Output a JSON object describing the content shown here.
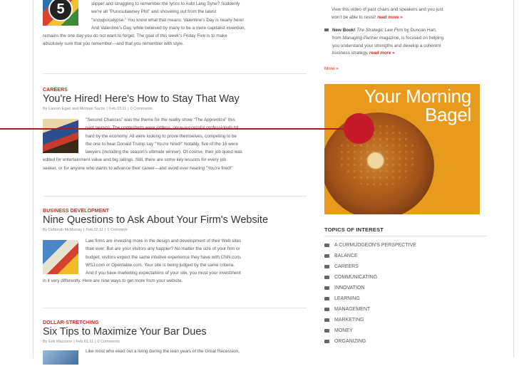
{
  "main": {
    "friday_five": {
      "lines": [
        "slipper and struggling to remember the lyrics to Auld Lang Syne? Suddenly",
        "we're all \"Punxsutawney Phil\" and shoveling out from the latest",
        "\"snowpocalypse.\" You know what that means: Valentine's Day is nearly here!",
        "And Valentine's Day, while believed by many to be a mere capitalist invention,",
        "remains the one day you do not want to forget. The goal of this week's Friday Five is to make",
        "absolutely sure that you remember—and that you remember with style."
      ],
      "badge_number": "5"
    },
    "articles": [
      {
        "category": "CAREERS",
        "title": "You're Hired! Here's How to Stay That Way",
        "authors": "By Lauren Egan and Michael Sachs",
        "date": "Feb.03.11",
        "comments": "0 Comments",
        "lines": [
          "\"Second Chances\" was the theme for the reality show \"The Apprentice\" this",
          "past season. The contestants were jobless, once-successful professionals hit",
          "hard by the economy. All were looking to prove themselves, competing to be",
          "the one to hear Donald Trump say \"You're hired!\" Notably, five of the 16 were",
          "lawyers (including the season's ultimate winner). Of course, their job quest was",
          "edited for entertainment value and big ratings. Still, there are some key lessons for every job",
          "seeker, or for anyone who wants to advance their career—and avoid ever hearing \"You're fired!\""
        ]
      },
      {
        "category": "BUSINESS DEVELOPMENT",
        "title": "Nine Questions to Ask About Your Firm's Website",
        "authors": "By Deborah McMurray",
        "date": "Feb.02.11",
        "comments": "1 Comment",
        "lines": [
          "Law firms are investing more in the design and development of their Web sites",
          "than ever. But are your visitors any happier? No matter the size of your firm or",
          "budget, visitors expect the same intuitive experience they have with CNN.com,",
          "WSJ.com or Opentable.com. Your site is being judged by the same criteria.",
          "And if you have marketing expectations of your site, you must your investment",
          "in it very differently. Here are nine ways to get more from your website."
        ]
      },
      {
        "category": "DOLLAR-STRETCHING",
        "title": "Six Tips to Maximize Your Bar Dues",
        "authors": "By Erik Mazzone",
        "date": "Feb.01.11",
        "comments": "0 Comments",
        "lines": [
          "Like most who eked out a living during the lean years of the Great Recession,"
        ]
      }
    ]
  },
  "sidebar": {
    "item1": {
      "line1": "View this video of past chairs and speakers and you just",
      "line2": "won't be able to resist!",
      "read_more": "read more »"
    },
    "item2": {
      "lead": "New Book!",
      "title": "The Strategic Law Firm",
      "by": " by Duncan Hart,",
      "line2_prefix": "from ",
      "magazine": "Managing Partner",
      "line2_suffix": " magazine, is focused on helping",
      "line3": "you understand your strengths and develop a coherent",
      "line4": "business strategy.",
      "read_more": "read more »"
    },
    "more": "More »",
    "ad": {
      "line1": "Your Morning",
      "line2": "Bagel"
    },
    "topics_title": "TOPICS OF INTEREST",
    "topics": [
      "A CURMUDGEON'S PERSPECTIVE",
      "BALANCE",
      "CAREERS",
      "COMMUNICATING",
      "INNOVATION",
      "LEARNING",
      "MANAGEMENT",
      "MARKETING",
      "MONEY",
      "ORGANIZING"
    ]
  },
  "colors": {
    "accent_red": "#cc2b1e",
    "ad_orange": "#e89a1c",
    "callout_red": "#c41a2a"
  }
}
